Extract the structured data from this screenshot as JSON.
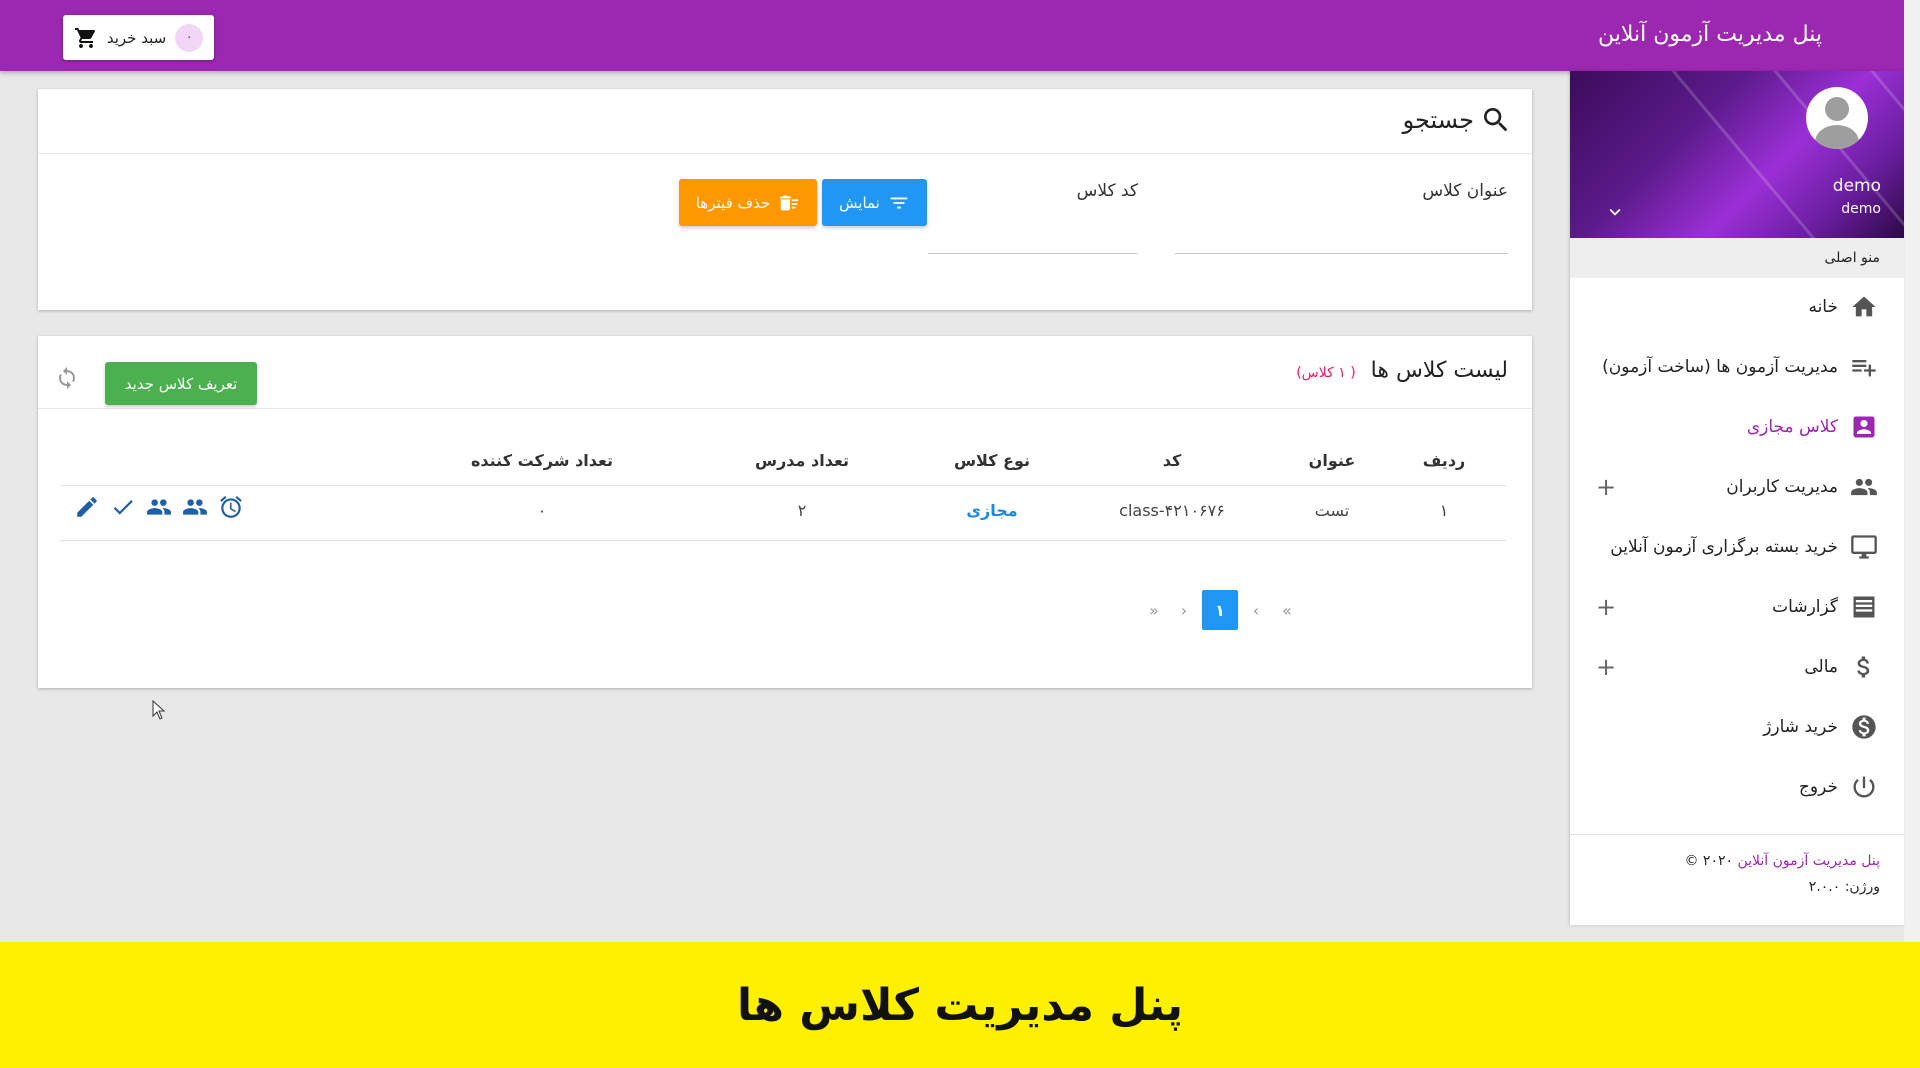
{
  "topbar": {
    "brand": "پنل مدیریت آزمون آنلاین",
    "cart_label": "سبد خرید",
    "cart_count": "۰"
  },
  "profile": {
    "name": "demo",
    "role": "demo"
  },
  "sidebar": {
    "header": "منو اصلی",
    "items": [
      {
        "label": "خانه",
        "icon": "home-icon",
        "expandable": false,
        "active": false
      },
      {
        "label": "مدیریت آزمون ها (ساخت آزمون)",
        "icon": "playlist-add-icon",
        "expandable": false,
        "active": false
      },
      {
        "label": "کلاس مجازی",
        "icon": "contact-icon",
        "expandable": false,
        "active": true
      },
      {
        "label": "مدیریت کاربران",
        "icon": "people-icon",
        "expandable": true,
        "active": false
      },
      {
        "label": "خرید بسته برگزاری آزمون آنلاین",
        "icon": "monitor-icon",
        "expandable": false,
        "active": false
      },
      {
        "label": "گزارشات",
        "icon": "list-icon",
        "expandable": true,
        "active": false
      },
      {
        "label": "مالی",
        "icon": "dollar-icon",
        "expandable": true,
        "active": false
      },
      {
        "label": "خرید شارژ",
        "icon": "dollar-circle-icon",
        "expandable": false,
        "active": false
      },
      {
        "label": "خروج",
        "icon": "power-icon",
        "expandable": false,
        "active": false
      }
    ],
    "footer": {
      "brand": "پنل مدیریت آزمون آنلاین",
      "year": "۲۰۲۰ ©",
      "version_label": "ورژن:",
      "version": "۲.۰.۰"
    }
  },
  "search": {
    "title": "جستجو",
    "fields": [
      {
        "label": "عنوان کلاس",
        "value": ""
      },
      {
        "label": "کد کلاس",
        "value": ""
      }
    ],
    "show_button": "نمایش",
    "clear_button": "حذف فیترها"
  },
  "list": {
    "title": "لیست کلاس ها",
    "count": "( ۱ کلاس)",
    "new_button": "تعریف کلاس جدید",
    "columns": [
      "ردیف",
      "عنوان",
      "کد",
      "نوع کلاس",
      "تعداد مدرس",
      "تعداد شرکت کننده"
    ],
    "rows": [
      {
        "index": "۱",
        "title": "تست",
        "code": "class-۴۲۱۰۶۷۶",
        "type": "مجازی",
        "teachers": "۲",
        "participants": "۰"
      }
    ],
    "row_actions": [
      "alarm-icon",
      "group-icon",
      "group-icon",
      "check-icon",
      "edit-icon"
    ],
    "pagination": {
      "first": "«",
      "prev": "‹",
      "current": "۱",
      "next": "›",
      "last": "»"
    }
  },
  "banner": {
    "text": "پنل مدیریت کلاس ها"
  },
  "colors": {
    "primary": "#9c27b0",
    "blue": "#2196f3",
    "orange": "#ff9800",
    "green": "#4caf50",
    "banner": "#fff000"
  }
}
